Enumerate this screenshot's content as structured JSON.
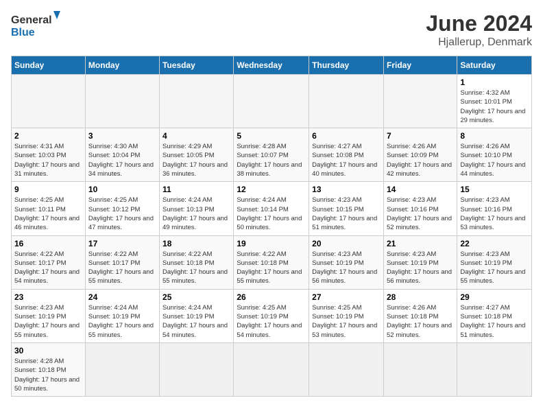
{
  "header": {
    "logo_general": "General",
    "logo_blue": "Blue",
    "title": "June 2024",
    "subtitle": "Hjallerup, Denmark"
  },
  "days_of_week": [
    "Sunday",
    "Monday",
    "Tuesday",
    "Wednesday",
    "Thursday",
    "Friday",
    "Saturday"
  ],
  "weeks": [
    {
      "days": [
        {
          "num": "",
          "empty": true
        },
        {
          "num": "",
          "empty": true
        },
        {
          "num": "",
          "empty": true
        },
        {
          "num": "",
          "empty": true
        },
        {
          "num": "",
          "empty": true
        },
        {
          "num": "",
          "empty": true
        },
        {
          "num": "1",
          "sunrise": "4:32 AM",
          "sunset": "10:01 PM",
          "daylight": "17 hours and 29 minutes."
        }
      ]
    },
    {
      "days": [
        {
          "num": "2",
          "sunrise": "4:31 AM",
          "sunset": "10:03 PM",
          "daylight": "17 hours and 31 minutes."
        },
        {
          "num": "3",
          "sunrise": "4:30 AM",
          "sunset": "10:04 PM",
          "daylight": "17 hours and 34 minutes."
        },
        {
          "num": "4",
          "sunrise": "4:29 AM",
          "sunset": "10:05 PM",
          "daylight": "17 hours and 36 minutes."
        },
        {
          "num": "5",
          "sunrise": "4:28 AM",
          "sunset": "10:07 PM",
          "daylight": "17 hours and 38 minutes."
        },
        {
          "num": "6",
          "sunrise": "4:27 AM",
          "sunset": "10:08 PM",
          "daylight": "17 hours and 40 minutes."
        },
        {
          "num": "7",
          "sunrise": "4:26 AM",
          "sunset": "10:09 PM",
          "daylight": "17 hours and 42 minutes."
        },
        {
          "num": "8",
          "sunrise": "4:26 AM",
          "sunset": "10:10 PM",
          "daylight": "17 hours and 44 minutes."
        }
      ]
    },
    {
      "days": [
        {
          "num": "9",
          "sunrise": "4:25 AM",
          "sunset": "10:11 PM",
          "daylight": "17 hours and 46 minutes."
        },
        {
          "num": "10",
          "sunrise": "4:25 AM",
          "sunset": "10:12 PM",
          "daylight": "17 hours and 47 minutes."
        },
        {
          "num": "11",
          "sunrise": "4:24 AM",
          "sunset": "10:13 PM",
          "daylight": "17 hours and 49 minutes."
        },
        {
          "num": "12",
          "sunrise": "4:24 AM",
          "sunset": "10:14 PM",
          "daylight": "17 hours and 50 minutes."
        },
        {
          "num": "13",
          "sunrise": "4:23 AM",
          "sunset": "10:15 PM",
          "daylight": "17 hours and 51 minutes."
        },
        {
          "num": "14",
          "sunrise": "4:23 AM",
          "sunset": "10:16 PM",
          "daylight": "17 hours and 52 minutes."
        },
        {
          "num": "15",
          "sunrise": "4:23 AM",
          "sunset": "10:16 PM",
          "daylight": "17 hours and 53 minutes."
        }
      ]
    },
    {
      "days": [
        {
          "num": "16",
          "sunrise": "4:22 AM",
          "sunset": "10:17 PM",
          "daylight": "17 hours and 54 minutes."
        },
        {
          "num": "17",
          "sunrise": "4:22 AM",
          "sunset": "10:17 PM",
          "daylight": "17 hours and 55 minutes."
        },
        {
          "num": "18",
          "sunrise": "4:22 AM",
          "sunset": "10:18 PM",
          "daylight": "17 hours and 55 minutes."
        },
        {
          "num": "19",
          "sunrise": "4:22 AM",
          "sunset": "10:18 PM",
          "daylight": "17 hours and 55 minutes."
        },
        {
          "num": "20",
          "sunrise": "4:23 AM",
          "sunset": "10:19 PM",
          "daylight": "17 hours and 56 minutes."
        },
        {
          "num": "21",
          "sunrise": "4:23 AM",
          "sunset": "10:19 PM",
          "daylight": "17 hours and 56 minutes."
        },
        {
          "num": "22",
          "sunrise": "4:23 AM",
          "sunset": "10:19 PM",
          "daylight": "17 hours and 55 minutes."
        }
      ]
    },
    {
      "days": [
        {
          "num": "23",
          "sunrise": "4:23 AM",
          "sunset": "10:19 PM",
          "daylight": "17 hours and 55 minutes."
        },
        {
          "num": "24",
          "sunrise": "4:24 AM",
          "sunset": "10:19 PM",
          "daylight": "17 hours and 55 minutes."
        },
        {
          "num": "25",
          "sunrise": "4:24 AM",
          "sunset": "10:19 PM",
          "daylight": "17 hours and 54 minutes."
        },
        {
          "num": "26",
          "sunrise": "4:25 AM",
          "sunset": "10:19 PM",
          "daylight": "17 hours and 54 minutes."
        },
        {
          "num": "27",
          "sunrise": "4:25 AM",
          "sunset": "10:19 PM",
          "daylight": "17 hours and 53 minutes."
        },
        {
          "num": "28",
          "sunrise": "4:26 AM",
          "sunset": "10:18 PM",
          "daylight": "17 hours and 52 minutes."
        },
        {
          "num": "29",
          "sunrise": "4:27 AM",
          "sunset": "10:18 PM",
          "daylight": "17 hours and 51 minutes."
        }
      ]
    },
    {
      "days": [
        {
          "num": "30",
          "sunrise": "4:28 AM",
          "sunset": "10:18 PM",
          "daylight": "17 hours and 50 minutes."
        },
        {
          "num": "",
          "empty": true
        },
        {
          "num": "",
          "empty": true
        },
        {
          "num": "",
          "empty": true
        },
        {
          "num": "",
          "empty": true
        },
        {
          "num": "",
          "empty": true
        },
        {
          "num": "",
          "empty": true
        }
      ]
    }
  ],
  "labels": {
    "sunrise_prefix": "Sunrise: ",
    "sunset_prefix": "Sunset: ",
    "daylight_prefix": "Daylight: "
  }
}
